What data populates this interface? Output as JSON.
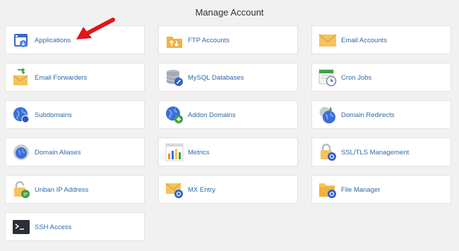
{
  "page": {
    "title": "Manage Account"
  },
  "tiles": [
    {
      "label": "Applications",
      "icon": "applications-icon"
    },
    {
      "label": "FTP Accounts",
      "icon": "ftp-icon"
    },
    {
      "label": "Email Accounts",
      "icon": "email-accounts-icon"
    },
    {
      "label": "Email Forwarders",
      "icon": "email-forwarders-icon"
    },
    {
      "label": "MySQL Databases",
      "icon": "mysql-databases-icon"
    },
    {
      "label": "Cron Jobs",
      "icon": "cron-jobs-icon"
    },
    {
      "label": "Subdomains",
      "icon": "subdomains-icon"
    },
    {
      "label": "Addon Domains",
      "icon": "addon-domains-icon"
    },
    {
      "label": "Domain Redirects",
      "icon": "domain-redirects-icon"
    },
    {
      "label": "Domain Aliases",
      "icon": "domain-aliases-icon"
    },
    {
      "label": "Metrics",
      "icon": "metrics-icon"
    },
    {
      "label": "SSL/TLS Management",
      "icon": "ssl-lock-icon"
    },
    {
      "label": "Unban IP Address",
      "icon": "unban-ip-icon"
    },
    {
      "label": "MX Entry",
      "icon": "mx-entry-icon"
    },
    {
      "label": "File Manager",
      "icon": "file-manager-icon"
    },
    {
      "label": "SSH Access",
      "icon": "ssh-terminal-icon"
    }
  ],
  "colors": {
    "label_link": "#2d6aa8",
    "annotation_arrow": "#e3161a",
    "globe_blue": "#3b6fd8",
    "envelope_yellow": "#f5c35c",
    "folder_yellow": "#f6c75b"
  }
}
